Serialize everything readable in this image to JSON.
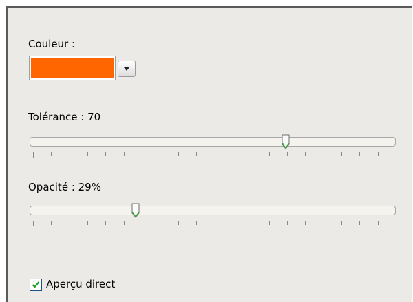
{
  "color": {
    "label": "Couleur :",
    "value": "#ff6600",
    "dropdown_icon": "chevron-down-icon"
  },
  "tolerance": {
    "label": "Tolérance : 70",
    "value": 70,
    "min": 0,
    "max": 100
  },
  "opacity": {
    "label": "Opacité : 29%",
    "value": 29,
    "min": 0,
    "max": 100
  },
  "live_preview": {
    "label": "Aperçu direct",
    "checked": true
  }
}
